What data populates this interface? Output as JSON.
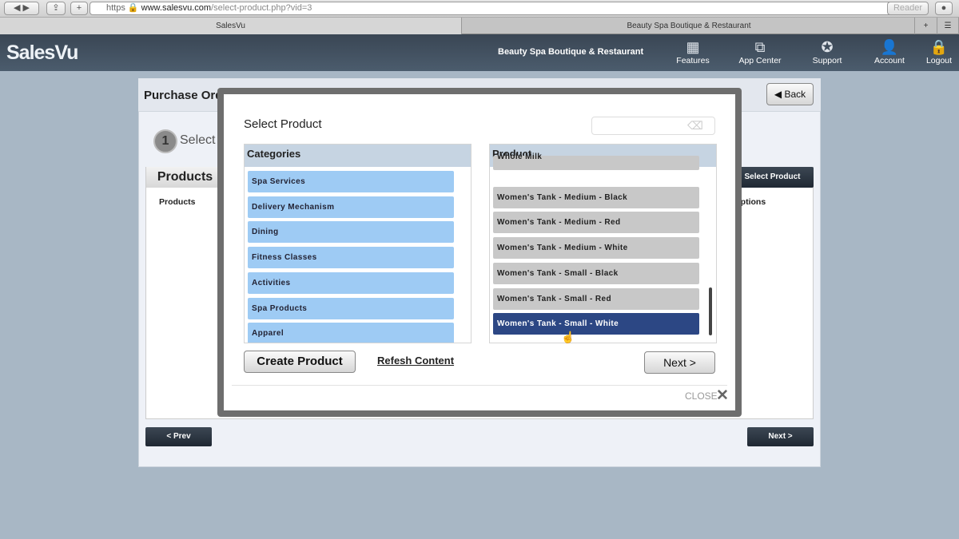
{
  "browser": {
    "url_host": "www.salesvu.com",
    "url_path": "/select-product.php?vid=3",
    "scheme": "https",
    "reader": "Reader",
    "tabs": [
      "SalesVu",
      "Beauty Spa Boutique & Restaurant"
    ]
  },
  "header": {
    "logo": "SalesVu",
    "business": "Beauty Spa Boutique & Restaurant",
    "nav": [
      {
        "label": "Features",
        "icon": "grid-icon"
      },
      {
        "label": "App Center",
        "icon": "puzzle-icon"
      },
      {
        "label": "Support",
        "icon": "lifebuoy-icon"
      },
      {
        "label": "Account",
        "icon": "user-icon"
      },
      {
        "label": "Logout",
        "icon": "lock-icon"
      }
    ]
  },
  "page": {
    "title": "Purchase Order Management (Vendor Name: Hill Country Provisions)",
    "back": "◀ Back",
    "step_number": "1",
    "step_label": "Select Vendor",
    "products_tab": "Products",
    "select_product": "Select Product",
    "col_products": "Products",
    "col_options": "Pricing Options",
    "prev": "< Prev",
    "next": "Next >"
  },
  "modal": {
    "title": "Select Product",
    "categories_header": "Categories",
    "product_header": "Product",
    "categories": [
      "Spa Services",
      "Delivery Mechanism",
      "Dining",
      "Fitness Classes",
      "Activities",
      "Spa Products",
      "Apparel"
    ],
    "products": [
      "Whole Milk",
      "Women's Tank - Medium - Black",
      "Women's Tank - Medium - Red",
      "Women's Tank - Medium - White",
      "Women's Tank - Small - Black",
      "Women's Tank - Small - Red",
      "Women's Tank - Small - White"
    ],
    "selected_product": "Women's Tank - Small - White",
    "create": "Create Product",
    "refresh": "Refesh Content",
    "next": "Next >",
    "close": "CLOSE"
  }
}
